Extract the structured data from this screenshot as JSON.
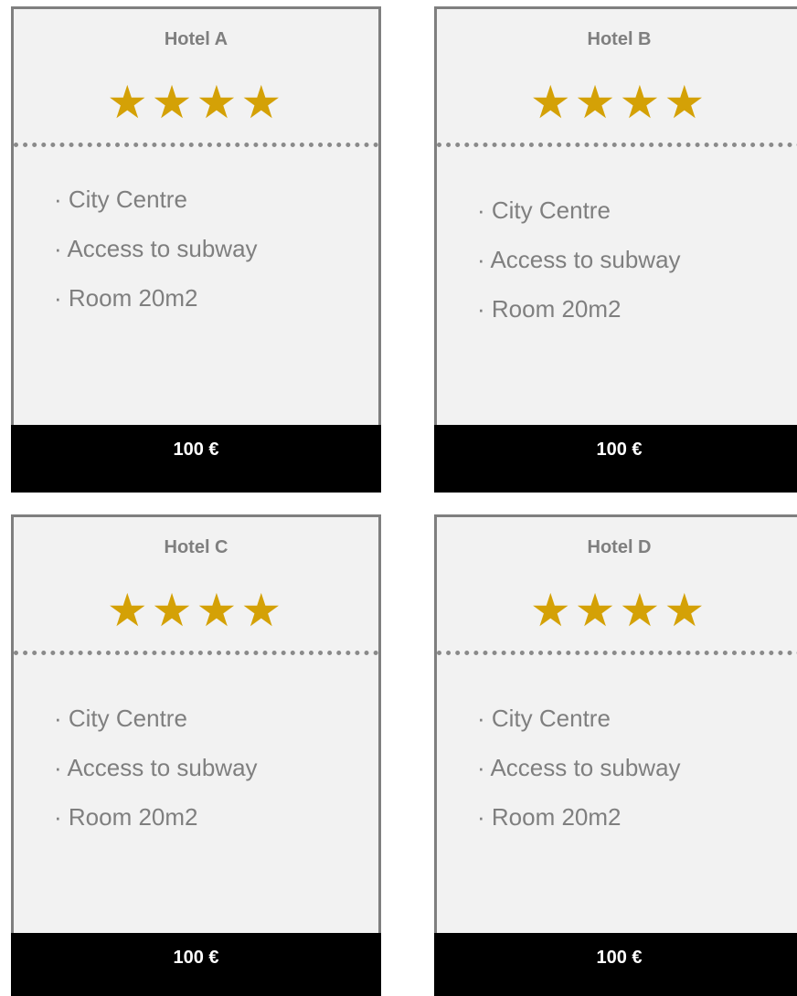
{
  "colors": {
    "card_background": "#f2f2f2",
    "card_border": "#7f7f7f",
    "star": "#d4a106",
    "price_bar": "#000000",
    "price_text": "#ffffff",
    "text": "#7f7f7f"
  },
  "cards": [
    {
      "title": "Hotel A",
      "rating": 4,
      "features": [
        "· City Centre",
        "· Access to subway",
        "· Room 20m2"
      ],
      "price": "100 €"
    },
    {
      "title": "Hotel B",
      "rating": 4,
      "features": [
        "· City Centre",
        "· Access to subway",
        "· Room 20m2"
      ],
      "price": "100 €"
    },
    {
      "title": "Hotel C",
      "rating": 4,
      "features": [
        "· City Centre",
        "· Access to subway",
        "· Room 20m2"
      ],
      "price": "100 €"
    },
    {
      "title": "Hotel D",
      "rating": 4,
      "features": [
        "· City Centre",
        "· Access to subway",
        "· Room 20m2"
      ],
      "price": "100 €"
    }
  ]
}
